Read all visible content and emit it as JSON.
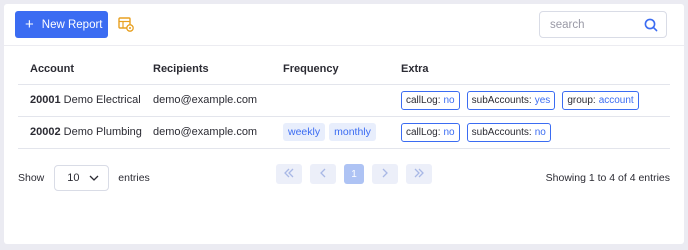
{
  "toolbar": {
    "new_report_label": "New Report",
    "new_report_icon": "plus-icon",
    "report_settings_icon": "table-settings-icon",
    "accent_color": "#3b6cf2",
    "search": {
      "placeholder": "search",
      "value": "",
      "icon": "search-icon"
    }
  },
  "table": {
    "headers": {
      "account": "Account",
      "recipients": "Recipients",
      "frequency": "Frequency",
      "extra": "Extra"
    },
    "rows": [
      {
        "account_id": "20001",
        "account_name": "Demo Electrical",
        "recipient": "demo@example.com",
        "frequency": [],
        "extra": [
          {
            "key": "callLog:",
            "value": "no"
          },
          {
            "key": "subAccounts:",
            "value": "yes"
          },
          {
            "key": "group:",
            "value": "account"
          }
        ]
      },
      {
        "account_id": "20002",
        "account_name": "Demo Plumbing",
        "recipient": "demo@example.com",
        "frequency": [
          "weekly",
          "monthly"
        ],
        "extra": [
          {
            "key": "callLog:",
            "value": "no"
          },
          {
            "key": "subAccounts:",
            "value": "no"
          }
        ]
      }
    ]
  },
  "footer": {
    "show_label": "Show",
    "page_size": "10",
    "entries_label": "entries",
    "current_page": "1",
    "pager_icons": [
      "double-chevron-left-icon",
      "chevron-left-icon",
      "chevron-right-icon",
      "double-chevron-right-icon"
    ],
    "showing_text": "Showing 1 to 4 of 4 entries"
  }
}
